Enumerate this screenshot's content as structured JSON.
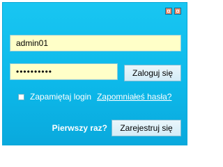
{
  "form": {
    "username_value": "admin01",
    "password_mask": "••••••••••",
    "login_label": "Zaloguj się",
    "remember_label": "Zapamiętaj login",
    "forgot_label": "Zapomniałeś hasła?",
    "first_time_label": "Pierwszy raz?",
    "register_label": "Zarejestruj się"
  },
  "controls": {
    "minimize_icon": "minimize-icon",
    "maximize_icon": "maximize-icon"
  }
}
